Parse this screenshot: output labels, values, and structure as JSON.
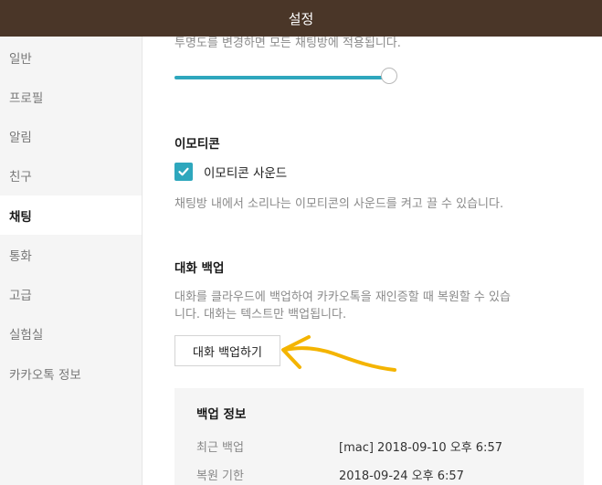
{
  "window": {
    "title": "설정"
  },
  "sidebar": {
    "items": [
      {
        "label": "일반"
      },
      {
        "label": "프로필"
      },
      {
        "label": "알림"
      },
      {
        "label": "친구"
      },
      {
        "label": "채팅",
        "active": true
      },
      {
        "label": "통화"
      },
      {
        "label": "고급"
      },
      {
        "label": "실험실"
      },
      {
        "label": "카카오톡 정보"
      }
    ]
  },
  "transparency": {
    "note": "투명도를 변경하면 모든 채팅방에 적용됩니다.",
    "slider_level_percent": 100
  },
  "emoticon": {
    "title": "이모티콘",
    "sound_label": "이모티콘 사운드",
    "sound_checked": true,
    "note": "채팅방 내에서 소리나는 이모티콘의 사운드를 켜고 끌 수 있습니다."
  },
  "backup": {
    "title": "대화 백업",
    "note_line1": "대화를 클라우드에 백업하여 카카오톡을 재인증할 때 복원할 수 있습",
    "note_line2": "니다. 대화는 텍스트만 백업됩니다.",
    "button_label": "대화 백업하기"
  },
  "backup_info": {
    "title": "백업 정보",
    "rows": [
      {
        "key": "최근 백업",
        "value": "[mac] 2018-09-10 오후 6:57"
      },
      {
        "key": "복원 기한",
        "value": "2018-09-24 오후 6:57"
      }
    ]
  },
  "colors": {
    "titlebar": "#4a3628",
    "accent": "#2ea7bd",
    "annotation_arrow": "#f4b400"
  }
}
